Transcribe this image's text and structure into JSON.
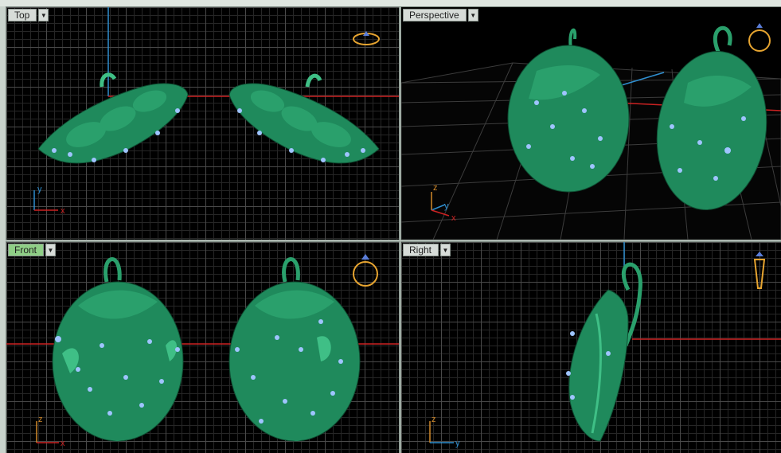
{
  "viewports": {
    "top": {
      "label": "Top",
      "axis_labels": [
        "y",
        "x"
      ]
    },
    "perspective": {
      "label": "Perspective",
      "axis_labels": [
        "z",
        "y",
        "x"
      ]
    },
    "front": {
      "label": "Front",
      "axis_labels": [
        "z",
        "x"
      ]
    },
    "right": {
      "label": "Right",
      "axis_labels": [
        "z",
        "y"
      ]
    }
  },
  "menu_arrow": "▼",
  "colors": {
    "model": "#1f8a5c",
    "model_light": "#3fbf86",
    "gem": "#9fc4ff",
    "axis_x": "#cc2222",
    "axis_y": "#2f8fd0",
    "axis_z": "#d38a2a",
    "ring_icon": "#e6a430",
    "active_tab": "#8fcf86"
  },
  "icons": [
    "ring-view-icon"
  ]
}
